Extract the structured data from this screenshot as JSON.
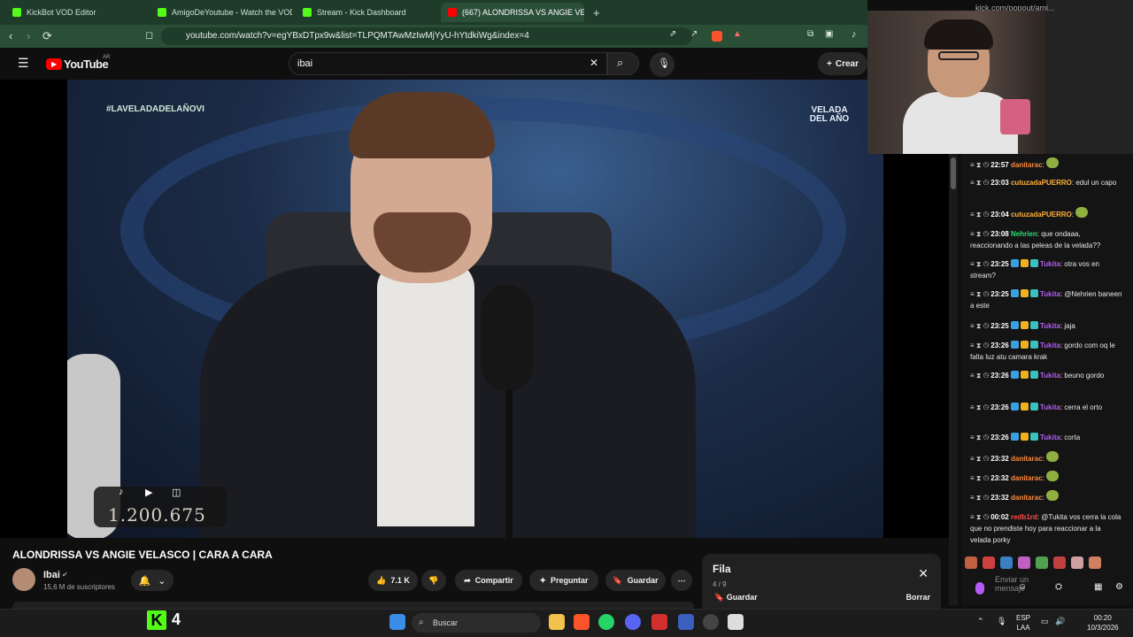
{
  "browser": {
    "tabs": [
      {
        "label": "KickBot VOD Editor",
        "icon_color": "#53fc18"
      },
      {
        "label": "AmigoDeYoutube - Watch the VOD o",
        "icon_color": "#53fc18"
      },
      {
        "label": "Stream - Kick Dashboard",
        "icon_color": "#53fc18"
      },
      {
        "label": "(667) ALONDRISSA VS ANGIE VE",
        "icon_color": "#ff0000"
      }
    ],
    "url": "youtube.com/watch?v=egYBxDTpx9w&list=TLPQMTAwMzIwMjYyU-hYtdkiWg&index=4",
    "popout_url": "kick.com/popout/ami..."
  },
  "youtube": {
    "logo_text": "YouTube",
    "region": "AR",
    "search_value": "ibai",
    "create_label": "Crear"
  },
  "video": {
    "hashtag": "#LAVELADADELAÑOVI",
    "brand": "VELADA DEL AÑO",
    "counter": "1.200.675",
    "title": "ALONDRISSA VS ANGIE VELASCO | CARA A CARA",
    "channel": "Ibai",
    "subscribers": "15,6 M de suscriptores",
    "likes": "7.1 K",
    "share_label": "Compartir",
    "ask_label": "Preguntar",
    "save_label": "Guardar"
  },
  "playlist": {
    "title": "Fila",
    "count": "4 / 9",
    "save_label": "Guardar",
    "clear_label": "Borrar"
  },
  "chat": {
    "messages": [
      {
        "time": "22:57",
        "user": "danitarac",
        "color": "#ff8a3d",
        "text": "",
        "emote": true
      },
      {
        "time": "23:03",
        "user": "cutuzadaPUERRO",
        "color": "#ffb13b",
        "text": "edul un capo"
      },
      {
        "time": "23:04",
        "user": "cutuzadaPUERRO",
        "color": "#ffb13b",
        "text": "",
        "emote": true
      },
      {
        "time": "23:08",
        "user": "Nehrien",
        "color": "#2fdc74",
        "text": "que ondaaa, reaccionando a las peleas de la velada??"
      },
      {
        "time": "23:25",
        "user": "Tukita",
        "color": "#b45cf5",
        "text": "otra vos en stream?"
      },
      {
        "time": "23:25",
        "user": "Tukita",
        "color": "#b45cf5",
        "text": "@Nehrien baneen a este"
      },
      {
        "time": "23:25",
        "user": "Tukita",
        "color": "#b45cf5",
        "text": "jaja"
      },
      {
        "time": "23:26",
        "user": "Tukita",
        "color": "#b45cf5",
        "text": "gordo com oq le falta luz atu camara krak"
      },
      {
        "time": "23:26",
        "user": "Tukita",
        "color": "#b45cf5",
        "text": "beuno gordo"
      },
      {
        "time": "23:26",
        "user": "Tukita",
        "color": "#b45cf5",
        "text": "cerra el orto"
      },
      {
        "time": "23:26",
        "user": "Tukita",
        "color": "#b45cf5",
        "text": "corta"
      },
      {
        "time": "23:32",
        "user": "danitarac",
        "color": "#ff8a3d",
        "text": "",
        "emote": true
      },
      {
        "time": "23:32",
        "user": "danitarac",
        "color": "#ff8a3d",
        "text": "",
        "emote": true
      },
      {
        "time": "23:32",
        "user": "danitarac",
        "color": "#ff8a3d",
        "text": "",
        "emote": true
      },
      {
        "time": "00:02",
        "user": "redb1rd",
        "color": "#ff4d4d",
        "text": "@Tukita vos cerra la cola que no prendiste hoy para reaccionar a la velada porky"
      }
    ],
    "input_placeholder": "Enviar un mensaje"
  },
  "taskbar": {
    "kick_number": "4",
    "search_label": "Buscar",
    "lang_1": "ESP",
    "lang_2": "LAA",
    "time": "00:20",
    "date": "10/3/2026"
  },
  "colors": {
    "kick_green": "#53fc18",
    "yt_red": "#ff0000",
    "chrome_green": "#2b4e37"
  }
}
